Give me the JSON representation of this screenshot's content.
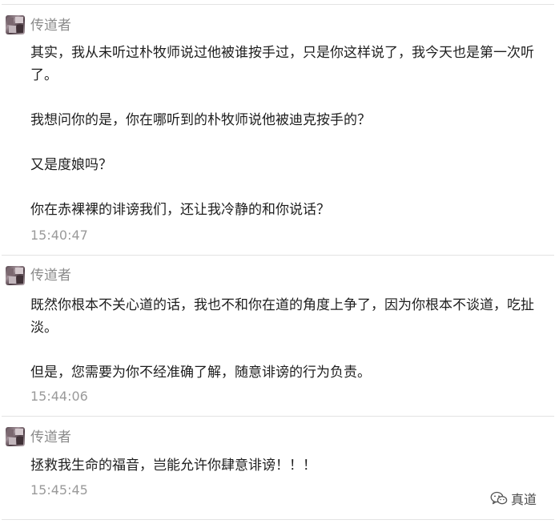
{
  "messages": [
    {
      "author": "传道者",
      "paragraphs": [
        "其实，我从未听过朴牧师说过他被谁按手过，只是你这样说了，我今天也是第一次听了。",
        "我想问你的是，你在哪听到的朴牧师说他被迪克按手的？",
        "又是度娘吗？",
        "你在赤裸裸的诽谤我们，还让我冷静的和你说话？"
      ],
      "time": "15:40:47"
    },
    {
      "author": "传道者",
      "paragraphs": [
        "既然你根本不关心道的话，我也不和你在道的角度上争了，因为你根本不谈道，吃扯淡。",
        "但是，您需要为你不经准确了解，随意诽谤的行为负责。"
      ],
      "time": "15:44:06"
    },
    {
      "author": "传道者",
      "paragraphs": [
        "拯救我生命的福音，岂能允许你肆意诽谤！！！"
      ],
      "time": "15:45:45"
    }
  ],
  "watermark": {
    "icon": "wechat-icon",
    "text": "真道"
  }
}
